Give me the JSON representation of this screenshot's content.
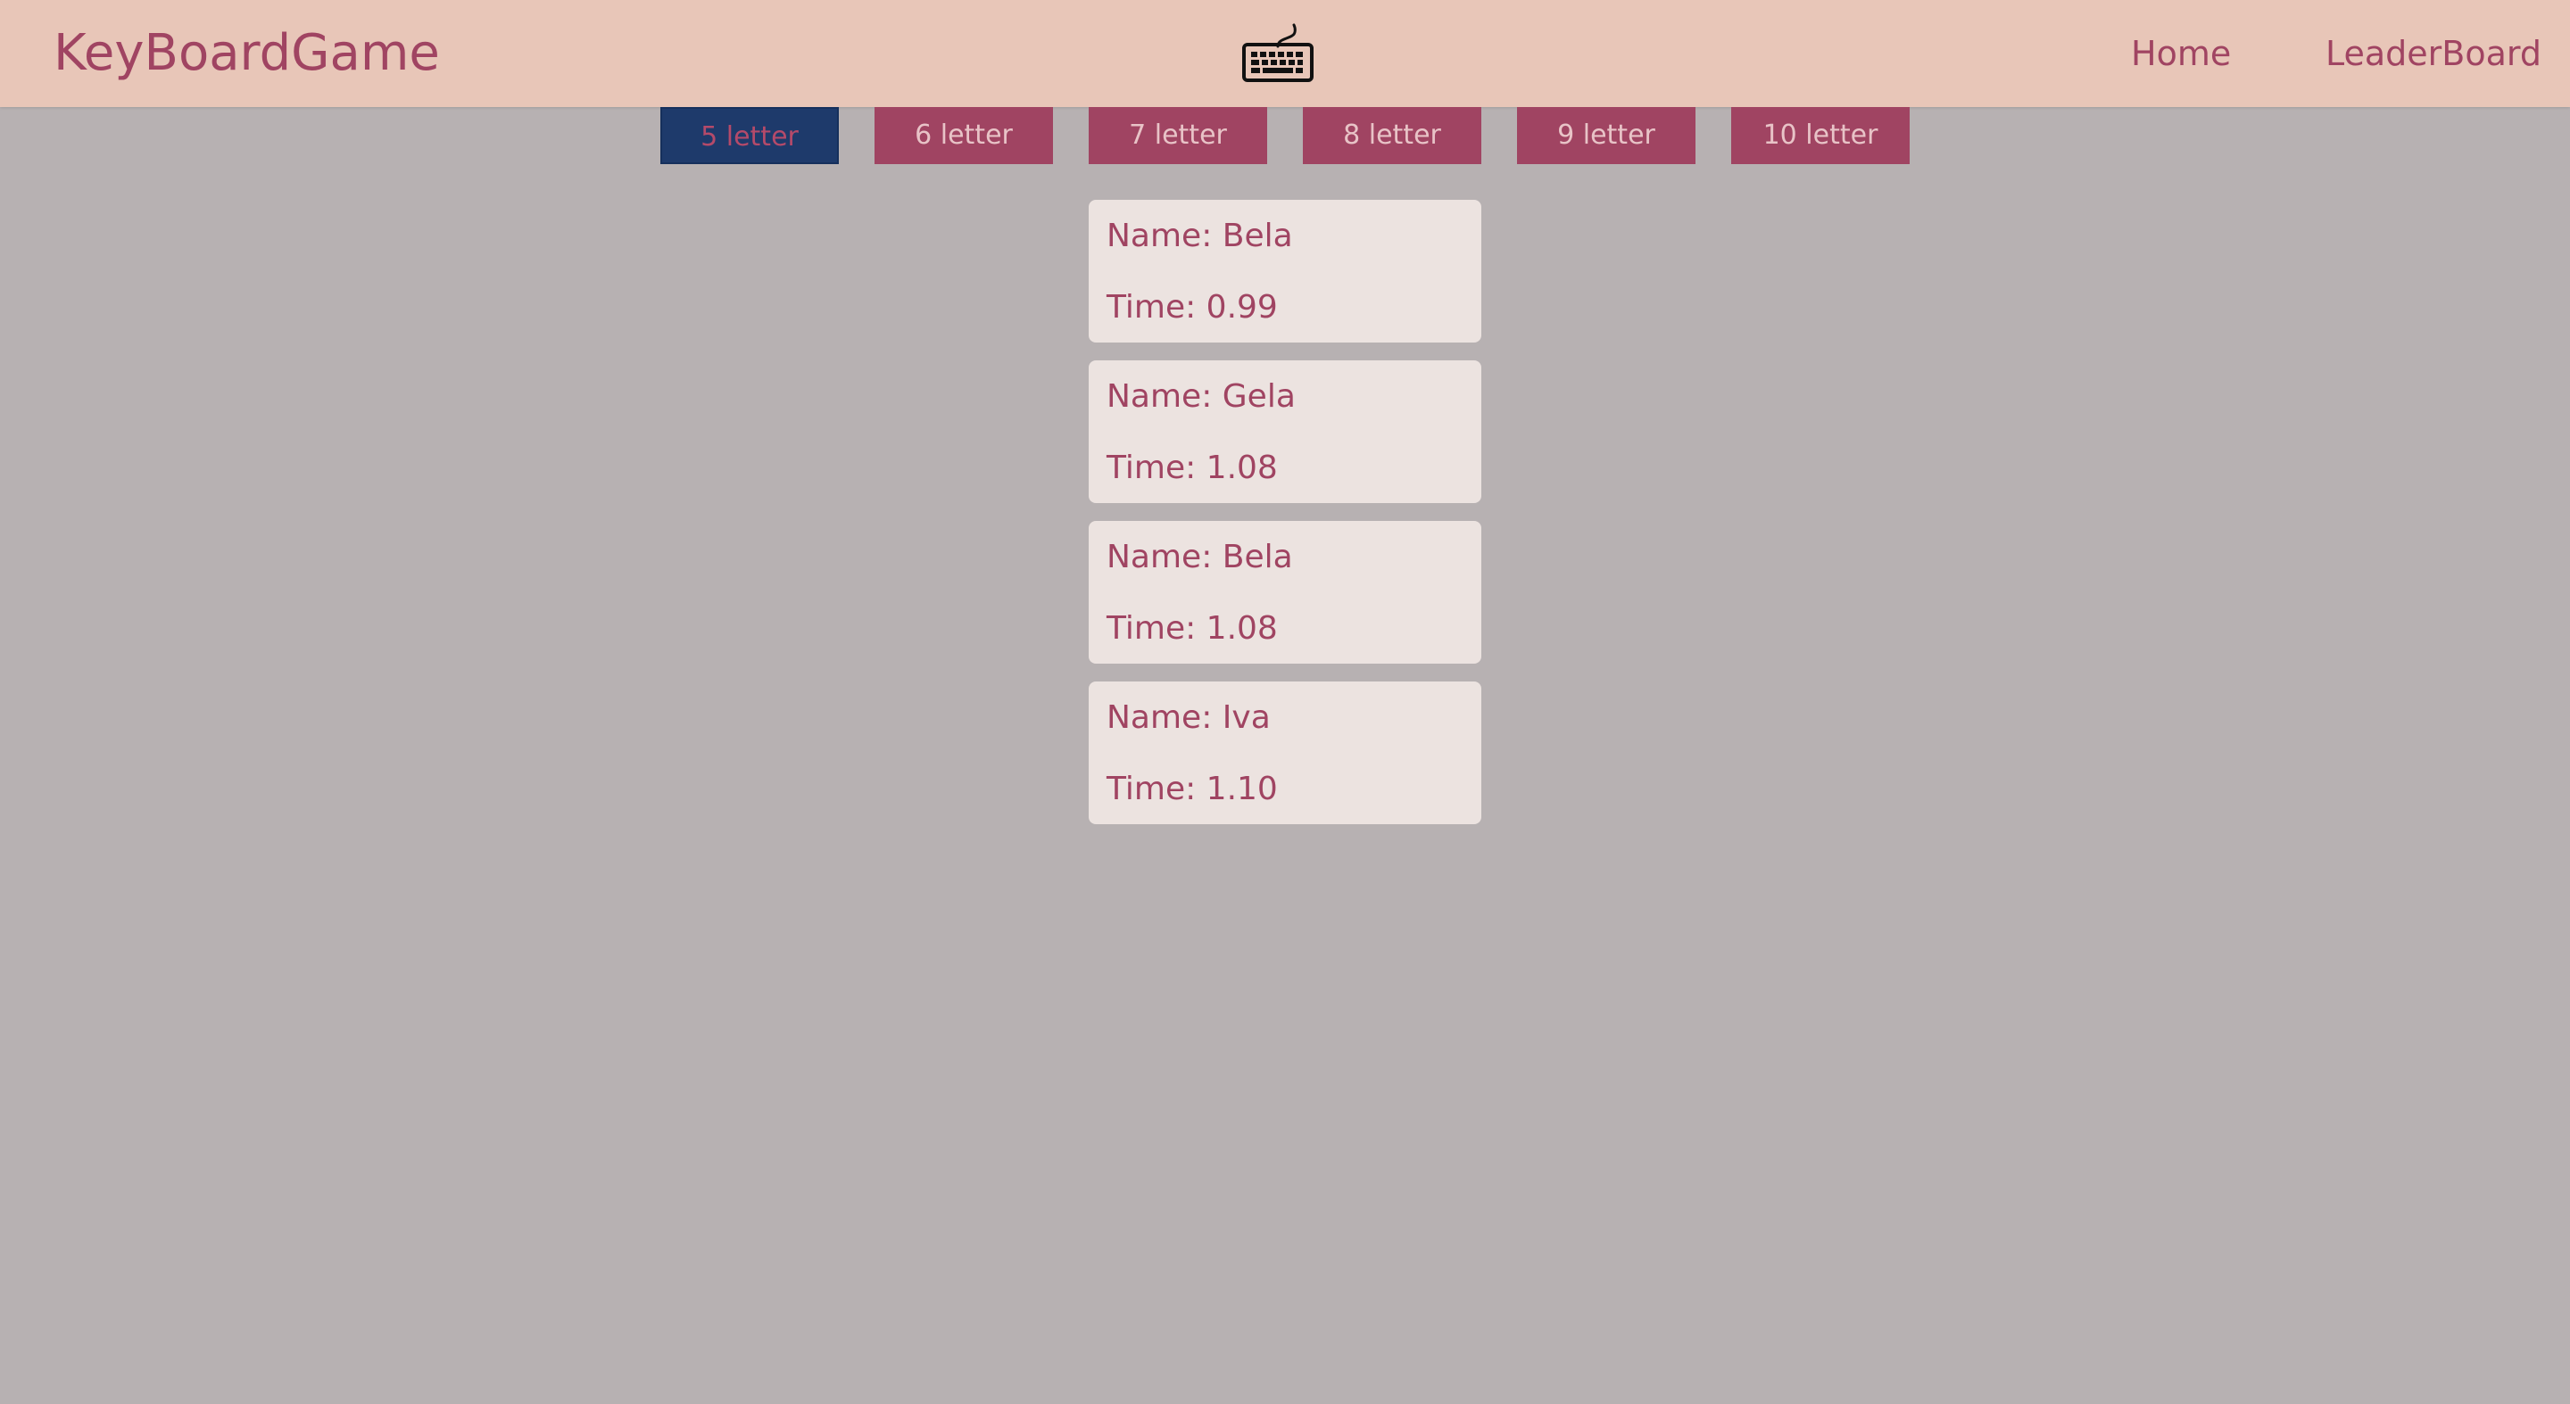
{
  "header": {
    "brand": "KeyBoardGame",
    "logo_icon": "keyboard-icon",
    "nav": [
      {
        "label": "Home"
      },
      {
        "label": "LeaderBoard"
      }
    ]
  },
  "filters": {
    "buttons": [
      {
        "label": "5 letter",
        "active": true
      },
      {
        "label": "6 letter",
        "active": false
      },
      {
        "label": "7 letter",
        "active": false
      },
      {
        "label": "8 letter",
        "active": false
      },
      {
        "label": "9 letter",
        "active": false
      },
      {
        "label": "10 letter",
        "active": false
      }
    ]
  },
  "leaderboard": {
    "name_prefix": "Name:",
    "time_prefix": "Time:",
    "entries": [
      {
        "name_line": "Name: Bela",
        "time_line": "Time: 0.99"
      },
      {
        "name_line": "Name: Gela",
        "time_line": "Time: 1.08"
      },
      {
        "name_line": "Name: Bela",
        "time_line": "Time: 1.08"
      },
      {
        "name_line": "Name: Iva",
        "time_line": "Time: 1.10"
      }
    ]
  },
  "colors": {
    "background": "#b7b1b2",
    "header_bg": "#e8c6b8",
    "accent": "#a04462",
    "active_button": "#1e3a6b",
    "card_bg": "#ece3e0"
  }
}
